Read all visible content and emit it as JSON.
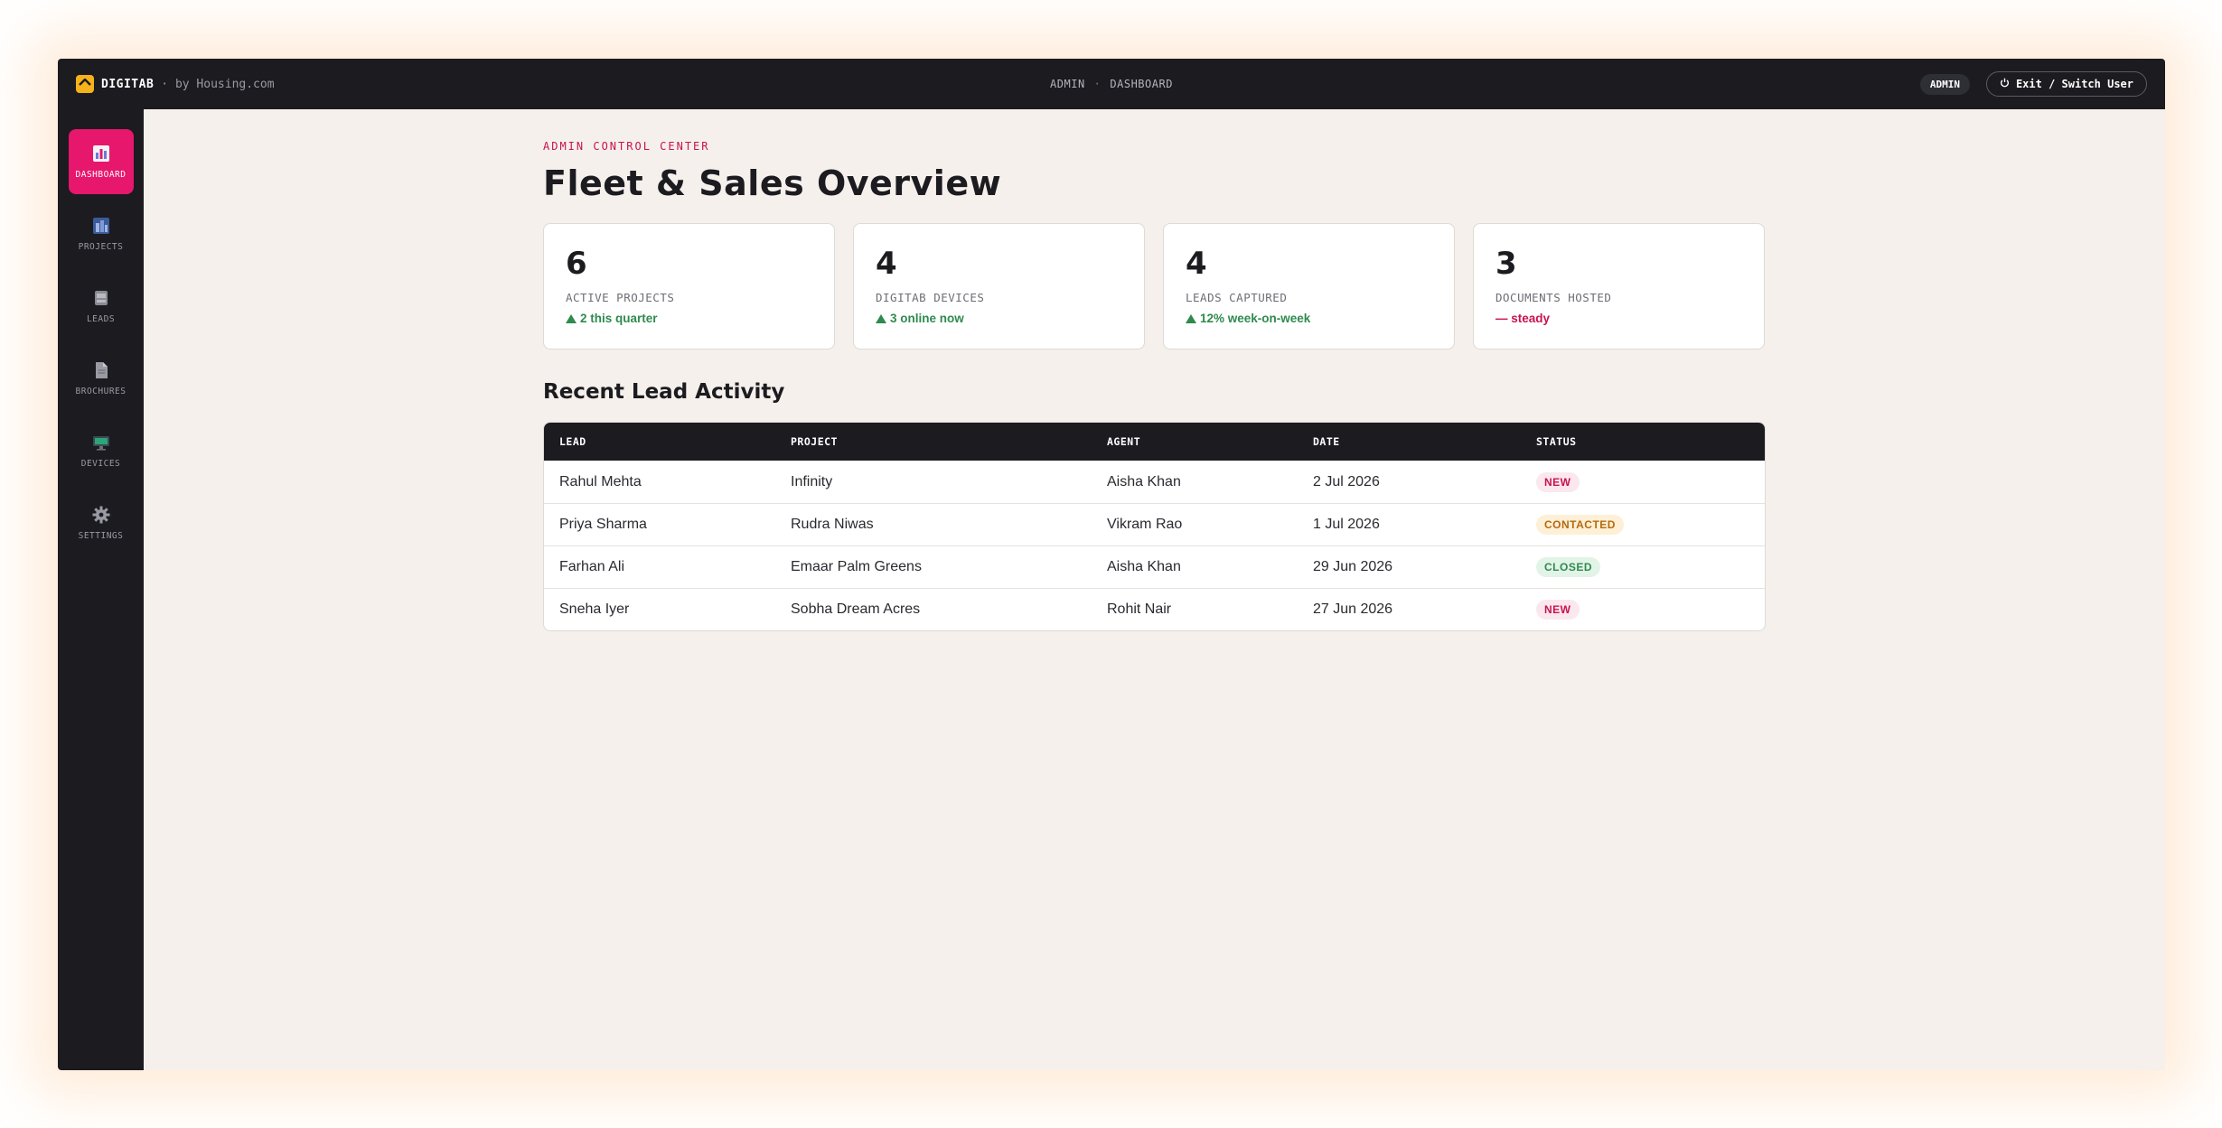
{
  "topbar": {
    "brand_name": "DIGITAB",
    "brand_by": "· by Housing.com",
    "crumb_section": "ADMIN",
    "crumb_sep": "·",
    "crumb_page": "DASHBOARD",
    "role_badge": "ADMIN",
    "exit_label": "Exit / Switch User"
  },
  "sidebar": {
    "items": [
      {
        "label": "DASHBOARD",
        "icon": "bar-chart-icon",
        "active": true
      },
      {
        "label": "PROJECTS",
        "icon": "city-icon",
        "active": false
      },
      {
        "label": "LEADS",
        "icon": "inbox-icon",
        "active": false
      },
      {
        "label": "BROCHURES",
        "icon": "document-icon",
        "active": false
      },
      {
        "label": "DEVICES",
        "icon": "monitor-icon",
        "active": false
      },
      {
        "label": "SETTINGS",
        "icon": "gear-icon",
        "active": false
      }
    ]
  },
  "main": {
    "eyebrow": "ADMIN CONTROL CENTER",
    "title": "Fleet & Sales Overview",
    "stats": [
      {
        "value": "6",
        "label": "ACTIVE PROJECTS",
        "delta": "2 this quarter",
        "trend": "up"
      },
      {
        "value": "4",
        "label": "DIGITAB DEVICES",
        "delta": "3 online now",
        "trend": "up"
      },
      {
        "value": "4",
        "label": "LEADS CAPTURED",
        "delta": "12% week-on-week",
        "trend": "up"
      },
      {
        "value": "3",
        "label": "DOCUMENTS HOSTED",
        "delta": "— steady",
        "trend": "flat"
      }
    ],
    "section_title": "Recent Lead Activity",
    "table": {
      "columns": [
        "LEAD",
        "PROJECT",
        "AGENT",
        "DATE",
        "STATUS"
      ],
      "rows": [
        {
          "lead": "Rahul Mehta",
          "project": "Infinity",
          "agent": "Aisha Khan",
          "date": "2 Jul 2026",
          "status": "NEW"
        },
        {
          "lead": "Priya Sharma",
          "project": "Rudra Niwas",
          "agent": "Vikram Rao",
          "date": "1 Jul 2026",
          "status": "CONTACTED"
        },
        {
          "lead": "Farhan Ali",
          "project": "Emaar Palm Greens",
          "agent": "Aisha Khan",
          "date": "29 Jun 2026",
          "status": "CLOSED"
        },
        {
          "lead": "Sneha Iyer",
          "project": "Sobha Dream Acres",
          "agent": "Rohit Nair",
          "date": "27 Jun 2026",
          "status": "NEW"
        }
      ]
    }
  },
  "colors": {
    "accent": "#e6176d",
    "dark": "#1b1b20",
    "background": "#f5f0ec",
    "positive": "#2f8a4e",
    "brand_logo": "#f6b21b"
  }
}
